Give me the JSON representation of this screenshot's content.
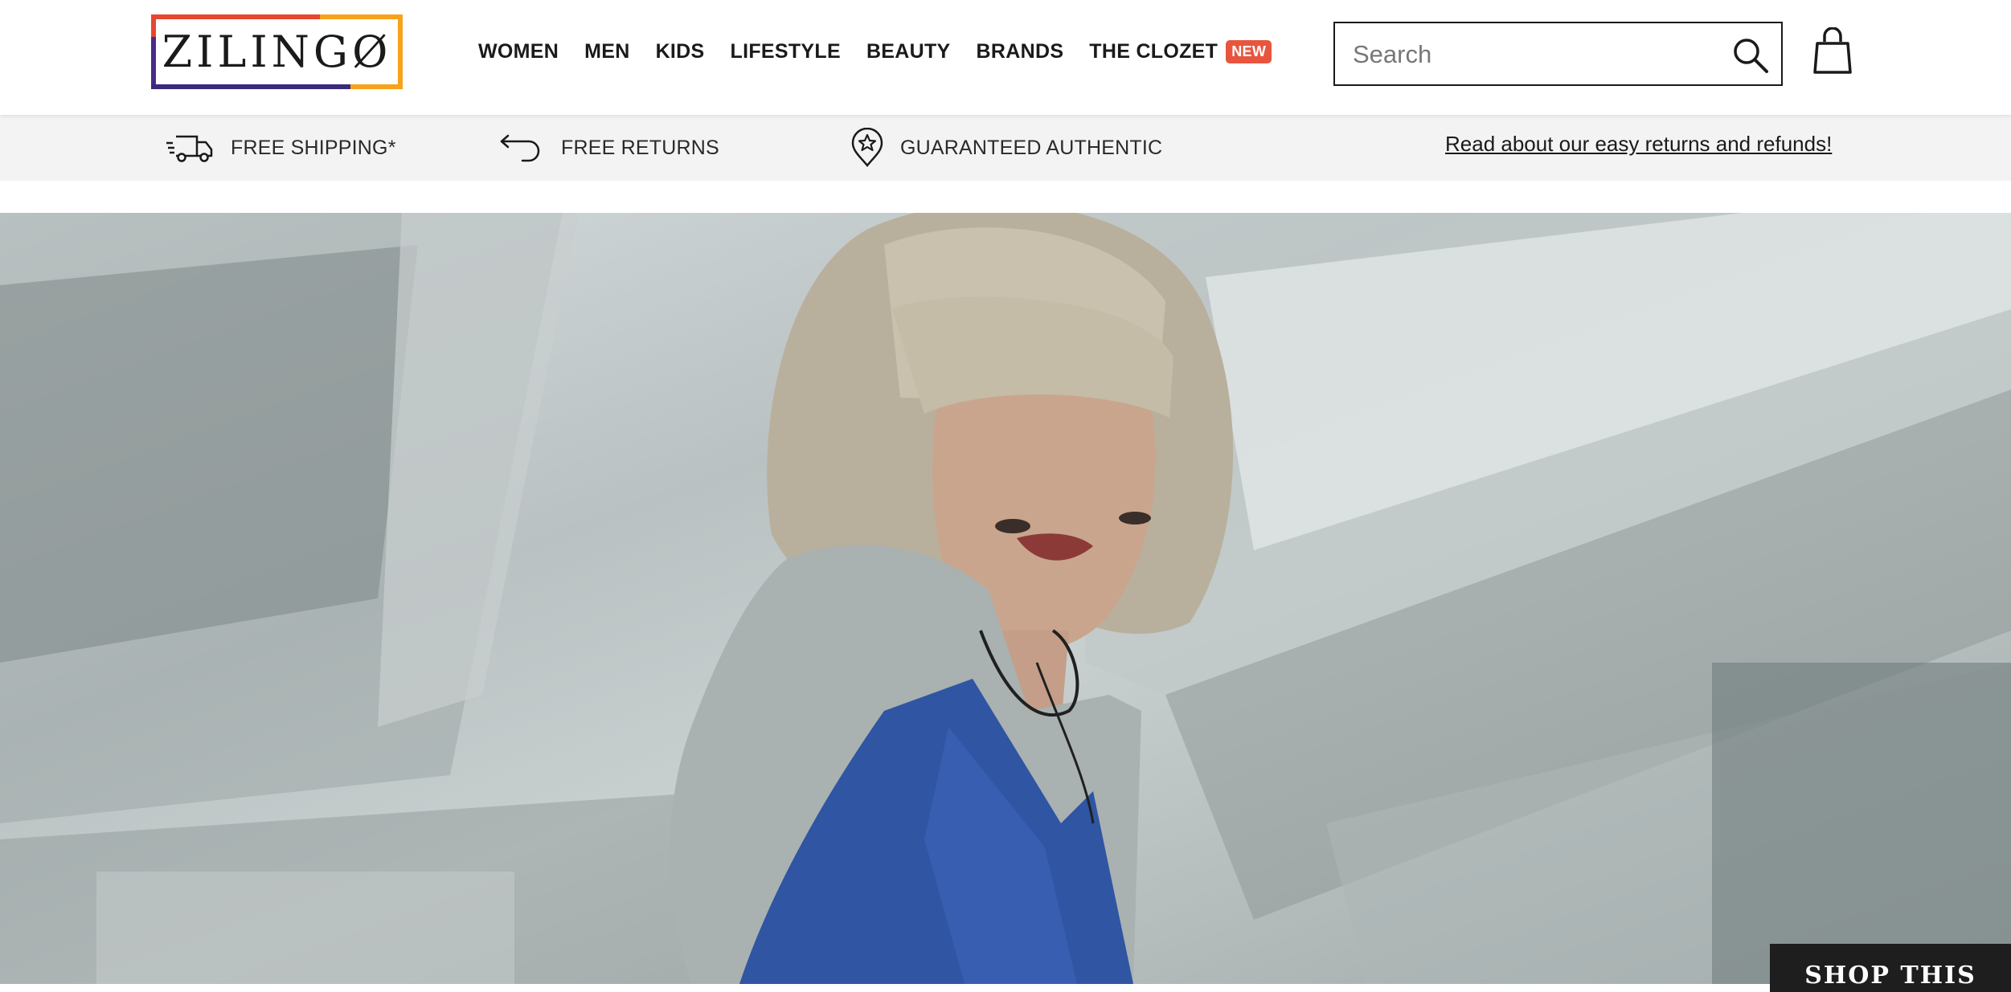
{
  "brand": {
    "name": "ZILINGØ",
    "colors": {
      "red": "#e8462f",
      "orange": "#f7a21b",
      "purple": "#3a2a7c"
    }
  },
  "nav": {
    "items": [
      {
        "label": "WOMEN"
      },
      {
        "label": "MEN"
      },
      {
        "label": "KIDS"
      },
      {
        "label": "LIFESTYLE"
      },
      {
        "label": "BEAUTY"
      },
      {
        "label": "BRANDS"
      },
      {
        "label": "THE CLOZET",
        "badge": "NEW"
      }
    ],
    "badge_color": "#e8553f"
  },
  "search": {
    "placeholder": "Search",
    "icon": "magnifier-icon"
  },
  "cart": {
    "icon": "shopping-bag-icon"
  },
  "benefits": [
    {
      "label": "FREE SHIPPING*",
      "icon": "delivery-truck-icon"
    },
    {
      "label": "FREE RETURNS",
      "icon": "return-arrow-icon"
    },
    {
      "label": "GUARANTEED AUTHENTIC",
      "icon": "star-badge-icon"
    }
  ],
  "returns_link": "Read about our easy returns and refunds!",
  "hero": {
    "cta_label": "SHOP THIS"
  }
}
